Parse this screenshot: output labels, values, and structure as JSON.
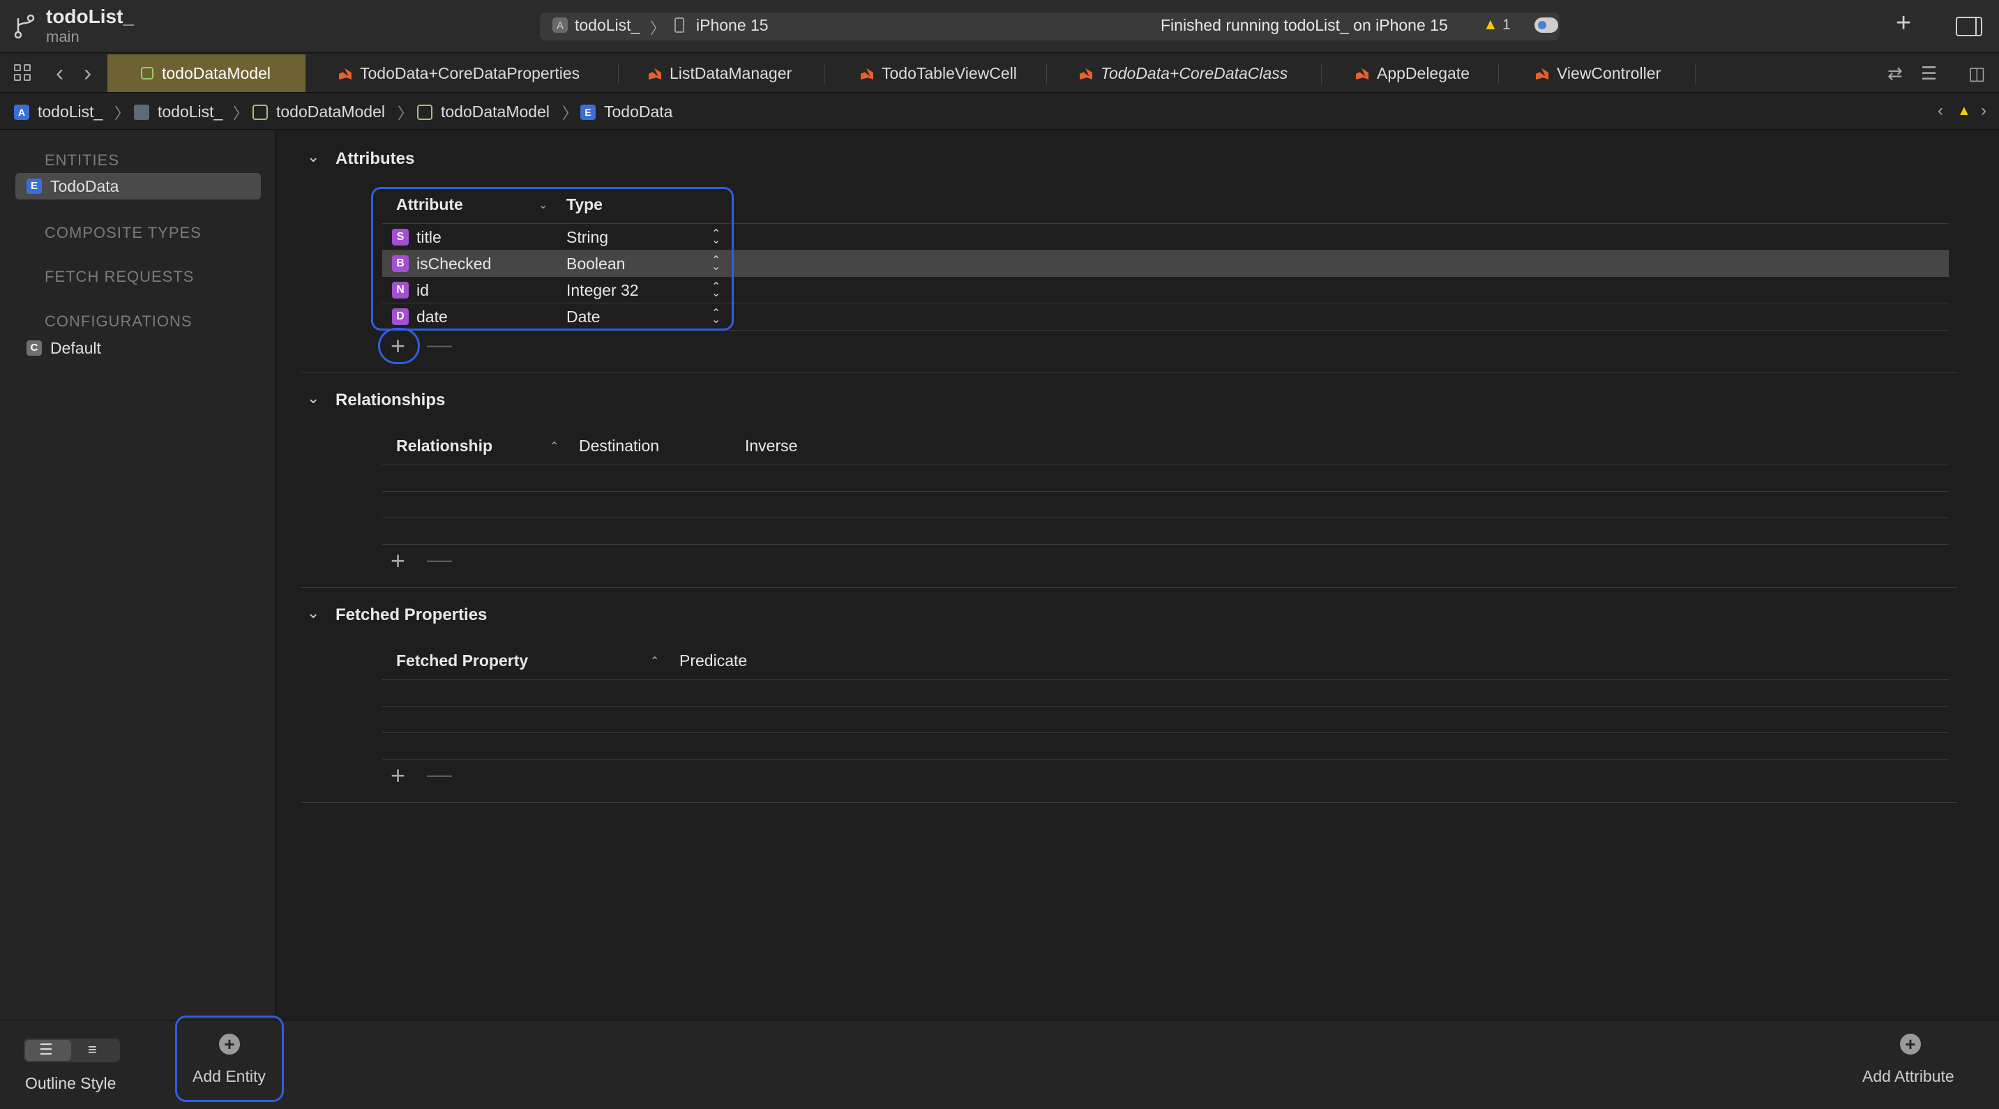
{
  "toolbar": {
    "project_name": "todoList_",
    "branch": "main",
    "scheme": "todoList_",
    "device": "iPhone 15",
    "status": "Finished running todoList_ on iPhone 15",
    "warning_count": "1"
  },
  "tabs": [
    {
      "label": "todoDataModel",
      "icon": "data-model-icon",
      "active": true
    },
    {
      "label": "TodoData+CoreDataProperties",
      "icon": "swift-file-icon"
    },
    {
      "label": "ListDataManager",
      "icon": "swift-file-icon"
    },
    {
      "label": "TodoTableViewCell",
      "icon": "swift-file-icon"
    },
    {
      "label": "TodoData+CoreDataClass",
      "icon": "swift-file-icon"
    },
    {
      "label": "AppDelegate",
      "icon": "swift-file-icon"
    },
    {
      "label": "ViewController",
      "icon": "swift-file-icon"
    }
  ],
  "breadcrumb": [
    "todoList_",
    "todoList_",
    "todoDataModel",
    "todoDataModel",
    "TodoData"
  ],
  "sidebar": {
    "entities_header": "ENTITIES",
    "entities": [
      {
        "badge": "E",
        "label": "TodoData"
      }
    ],
    "composite_header": "COMPOSITE TYPES",
    "fetch_header": "FETCH REQUESTS",
    "config_header": "CONFIGURATIONS",
    "configurations": [
      {
        "badge": "C",
        "label": "Default"
      }
    ]
  },
  "attributes": {
    "title": "Attributes",
    "col_attribute": "Attribute",
    "col_type": "Type",
    "rows": [
      {
        "badge": "S",
        "name": "title",
        "type": "String"
      },
      {
        "badge": "B",
        "name": "isChecked",
        "type": "Boolean"
      },
      {
        "badge": "N",
        "name": "id",
        "type": "Integer 32"
      },
      {
        "badge": "D",
        "name": "date",
        "type": "Date"
      }
    ]
  },
  "relationships": {
    "title": "Relationships",
    "col_relationship": "Relationship",
    "col_destination": "Destination",
    "col_inverse": "Inverse"
  },
  "fetched": {
    "title": "Fetched Properties",
    "col_property": "Fetched Property",
    "col_predicate": "Predicate"
  },
  "bottom": {
    "outline_style": "Outline Style",
    "add_entity": "Add Entity",
    "add_attribute": "Add Attribute"
  },
  "colors": {
    "accent_highlight": "#2f5fe0",
    "active_tab": "#6e6232",
    "attribute_badge": "#a34fd1",
    "entity_badge": "#3b6fd6",
    "warning": "#f5c518"
  }
}
